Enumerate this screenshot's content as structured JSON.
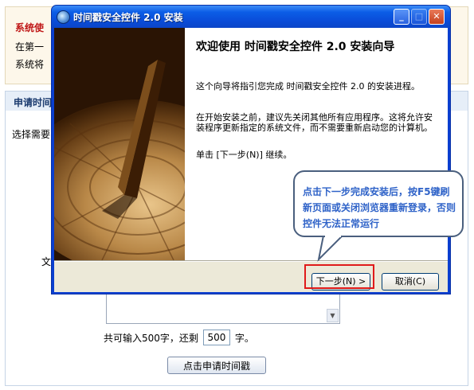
{
  "page": {
    "notice": {
      "title": "系统使",
      "line1": "在第一",
      "line2": "系统将"
    },
    "apply_title": "申请时间",
    "select_label": "选择需要",
    "text_label": "文",
    "chars_prefix": "共可输入500字，还剩",
    "chars_remaining": "500",
    "chars_suffix": "字。",
    "submit_label": "点击申请时间戳"
  },
  "installer": {
    "title": "时间戳安全控件 2.0 安装",
    "minimize_glyph": "_",
    "maximize_glyph": "□",
    "close_glyph": "✕",
    "welcome_heading": "欢迎使用 时间戳安全控件 2.0 安装向导",
    "para1": "这个向导将指引您完成 时间戳安全控件 2.0 的安装进程。",
    "para2": "在开始安装之前，建议先关闭其他所有应用程序。这将允许安装程序更新指定的系统文件，而不需要重新启动您的计算机。",
    "para3": "单击 [下一步(N)] 继续。",
    "next_button": "下一步(N) >",
    "cancel_button": "取消(C)"
  },
  "callout": {
    "text": "点击下一步完成安装后，按F5键刷新页面或关闭浏览器重新登录，否则控件无法正常运行"
  },
  "colors": {
    "titlebar": "#0b5de6",
    "callout_text": "#2e62c8",
    "highlight_border": "#e01a1a",
    "notice_title": "#c01818"
  },
  "icons": [
    "installer-app-icon",
    "minimize-icon",
    "maximize-icon",
    "close-icon",
    "sundial-image",
    "scroll-down-icon"
  ]
}
